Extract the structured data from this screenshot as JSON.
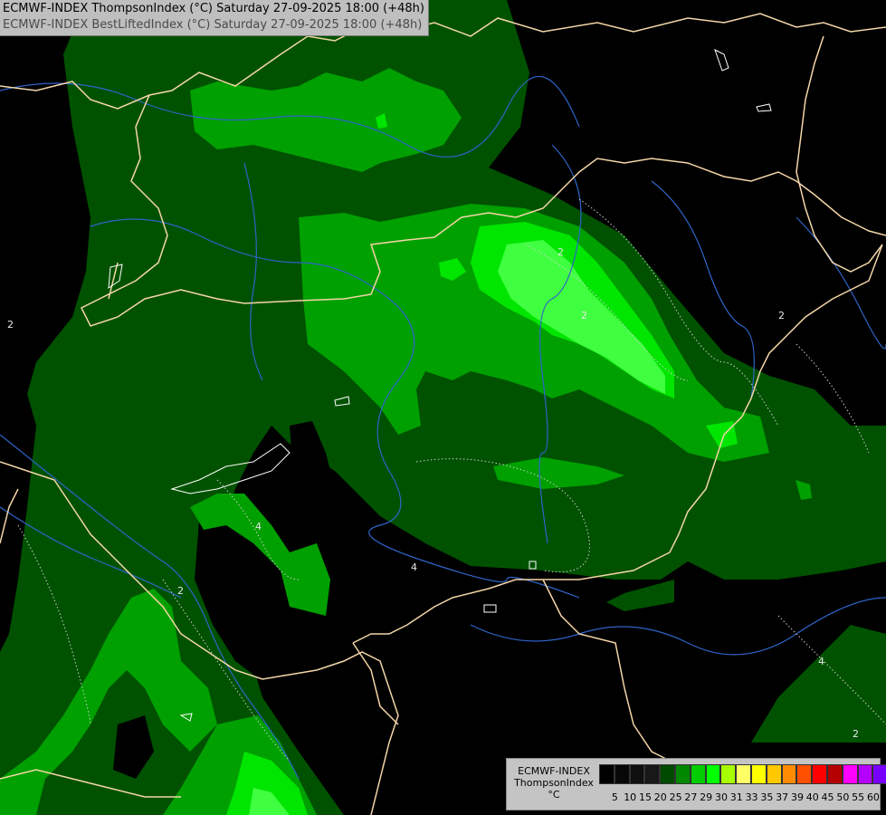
{
  "header": {
    "line1": "ECMWF-INDEX ThompsonIndex (°C) Saturday 27-09-2025 18:00 (+48h)",
    "line2": "ECMWF-INDEX BestLiftedIndex (°C) Saturday 27-09-2025 18:00 (+48h)"
  },
  "legend": {
    "model": "ECMWF-INDEX",
    "parameter": "ThompsonIndex",
    "unit": "°C",
    "swatch_colors": [
      "#000000",
      "#080808",
      "#101010",
      "#181818",
      "#004a00",
      "#008800",
      "#00cc00",
      "#00ff00",
      "#a8ff00",
      "#ffff66",
      "#ffff00",
      "#ffc800",
      "#ff8c00",
      "#ff5000",
      "#ff0000",
      "#b40000",
      "#ff00ff",
      "#b400ff",
      "#7800ff",
      "#3c00ff",
      "#0000ff"
    ],
    "ticks": [
      "5",
      "10",
      "15",
      "20",
      "25",
      "27",
      "29",
      "30",
      "31",
      "33",
      "35",
      "37",
      "39",
      "40",
      "45",
      "50",
      "55",
      "60"
    ]
  },
  "contour_labels": [
    "2",
    "2",
    "2",
    "4",
    "4",
    "2",
    "4",
    "2",
    "2"
  ],
  "colors": {
    "background": "#000000",
    "dark_green": "#005200",
    "mid_green": "#00a000",
    "bright_green": "#00e600",
    "light_green": "#40ff40",
    "borders": "#f5d6a8",
    "rivers": "#2f64c8",
    "contours": "#cfcfcf"
  }
}
